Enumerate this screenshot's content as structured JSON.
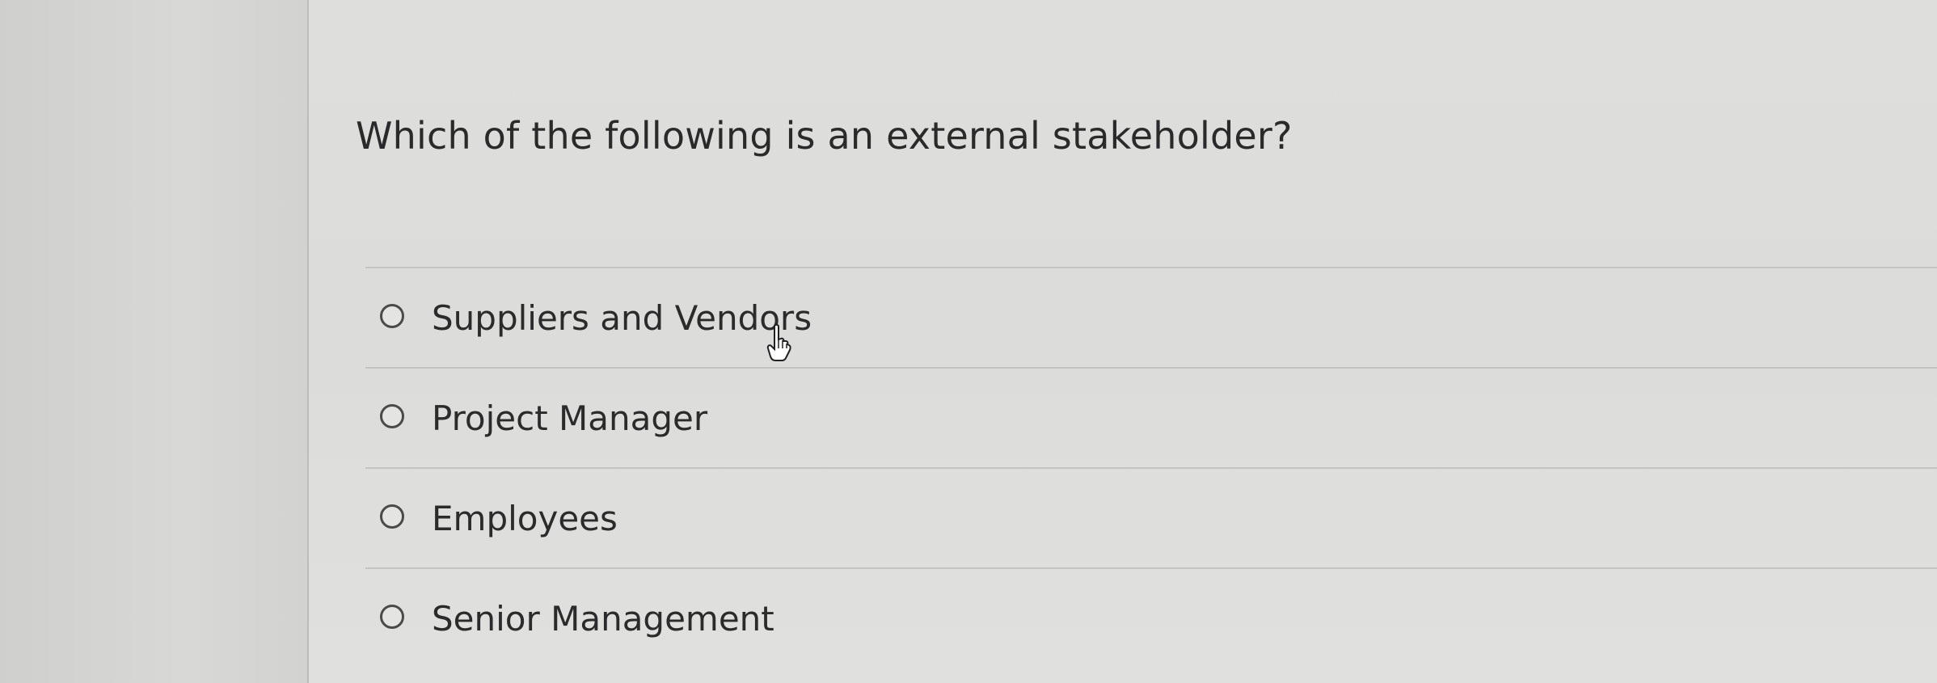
{
  "question": {
    "text": "Which of the following is an external stakeholder?"
  },
  "answers": [
    {
      "label": "Suppliers and Vendors"
    },
    {
      "label": "Project Manager"
    },
    {
      "label": "Employees"
    },
    {
      "label": "Senior Management"
    }
  ],
  "colors": {
    "background": "#d6d6d4",
    "text": "#2a2a2a",
    "divider": "#c3c3c1",
    "radio_border": "#4a4a4a"
  },
  "icons": {
    "cursor": "hand-cursor-icon",
    "radio": "radio-circle-icon"
  }
}
